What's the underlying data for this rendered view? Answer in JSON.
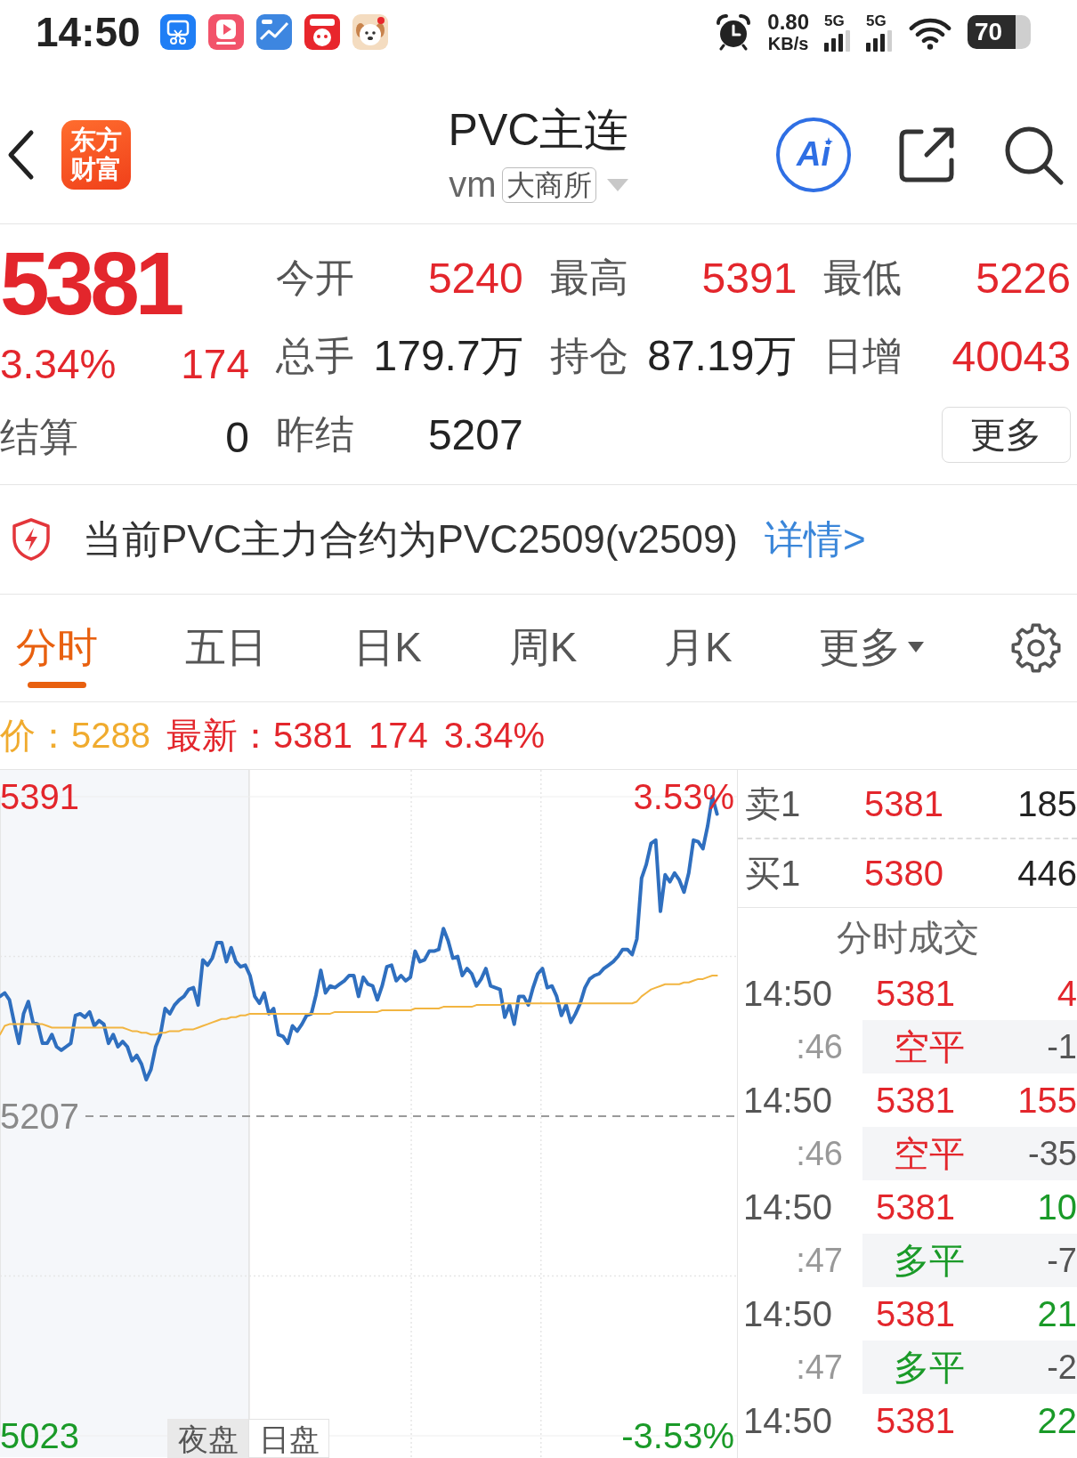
{
  "status_bar": {
    "time": "14:50",
    "speed": "0.80",
    "speed_unit": "KB/s",
    "networks": [
      "5G",
      "5G"
    ],
    "battery": "70"
  },
  "header": {
    "logo": [
      "东方",
      "财富"
    ],
    "title": "PVC主连",
    "code": "vm",
    "exchange": "大商所",
    "ai_label": "Ai"
  },
  "quote": {
    "price": "5381",
    "change_percent": "3.34%",
    "change": "174",
    "settle_label": "结算",
    "settle": "0",
    "stats": [
      {
        "label": "今开",
        "value": "5240",
        "color": "#e3262c"
      },
      {
        "label": "最高",
        "value": "5391",
        "color": "#e3262c"
      },
      {
        "label": "最低",
        "value": "5226",
        "color": "#e3262c"
      },
      {
        "label": "总手",
        "value": "179.7万",
        "color": "#222222"
      },
      {
        "label": "持仓",
        "value": "87.19万",
        "color": "#222222"
      },
      {
        "label": "日增",
        "value": "40043",
        "color": "#e3262c"
      },
      {
        "label": "昨结",
        "value": "5207",
        "color": "#222222"
      }
    ],
    "more": "更多"
  },
  "notice": {
    "text": "当前PVC主力合约为PVC2509(v2509)",
    "link": "详情>"
  },
  "tabs": [
    {
      "label": "分时",
      "selected": true,
      "kind": "tab"
    },
    {
      "label": "五日",
      "selected": false,
      "kind": "tab"
    },
    {
      "label": "日K",
      "selected": false,
      "kind": "tab"
    },
    {
      "label": "周K",
      "selected": false,
      "kind": "tab"
    },
    {
      "label": "月K",
      "selected": false,
      "kind": "tab"
    },
    {
      "label": "更多",
      "selected": false,
      "kind": "dropdown"
    }
  ],
  "summary": [
    {
      "text": "价：5288",
      "color": "#f0ab2e"
    },
    {
      "text": "最新：5381",
      "color": "#e3262c"
    },
    {
      "text": "174",
      "color": "#e3262c"
    },
    {
      "text": "3.34%",
      "color": "#e3262c"
    }
  ],
  "chart": {
    "chart_data": {
      "type": "line",
      "ylim": [
        5023,
        5391
      ],
      "yticks": [
        {
          "value": 5391,
          "label": "5391"
        },
        {
          "value": 5207,
          "label": "5207"
        },
        {
          "value": 5023,
          "label": "5023"
        }
      ],
      "ref_lines": [
        {
          "axis": "y",
          "value": 5207
        }
      ],
      "series": [
        {
          "color": "#2f6fbf",
          "values": [
            5276,
            5278,
            5274,
            5261,
            5249,
            5266,
            5273,
            5261,
            5260,
            5249,
            5249,
            5254,
            5247,
            5245,
            5247,
            5249,
            5265,
            5266,
            5264,
            5267,
            5259,
            5262,
            5260,
            5249,
            5254,
            5247,
            5250,
            5247,
            5239,
            5242,
            5237,
            5228,
            5234,
            5247,
            5254,
            5269,
            5266,
            5271,
            5274,
            5276,
            5280,
            5281,
            5271,
            5297,
            5294,
            5298,
            5307,
            5307,
            5296,
            5304,
            5296,
            5293,
            5294,
            5288,
            5276,
            5272,
            5278,
            5266,
            5269,
            5254,
            5253,
            5249,
            5259,
            5256,
            5260,
            5265,
            5266,
            5277,
            5291,
            5278,
            5282,
            5281,
            5283,
            5285,
            5288,
            5288,
            5276,
            5287,
            5283,
            5282,
            5274,
            5282,
            5293,
            5294,
            5285,
            5288,
            5285,
            5287,
            5302,
            5296,
            5297,
            5302,
            5302,
            5303,
            5315,
            5308,
            5298,
            5299,
            5288,
            5292,
            5289,
            5282,
            5286,
            5292,
            5282,
            5281,
            5280,
            5264,
            5271,
            5260,
            5276,
            5276,
            5271,
            5281,
            5289,
            5292,
            5281,
            5282,
            5276,
            5265,
            5271,
            5261,
            5266,
            5272,
            5281,
            5286,
            5288,
            5289,
            5292,
            5294,
            5296,
            5299,
            5303,
            5303,
            5300,
            5309,
            5344,
            5352,
            5364,
            5366,
            5325,
            5346,
            5342,
            5347,
            5343,
            5336,
            5347,
            5366,
            5365,
            5361,
            5374,
            5391,
            5381
          ]
        },
        {
          "color": "#f2b541",
          "values": [
            5254,
            5259,
            5260,
            5260,
            5260,
            5260,
            5260,
            5260,
            5260,
            5260,
            5259,
            5258,
            5258,
            5258,
            5258,
            5258,
            5258,
            5258,
            5258,
            5258,
            5258,
            5258,
            5258,
            5258,
            5258,
            5258,
            5258,
            5257,
            5256,
            5256,
            5255,
            5255,
            5254,
            5254,
            5255,
            5255,
            5256,
            5256,
            5256,
            5257,
            5257,
            5257,
            5258,
            5259,
            5260,
            5261,
            5262,
            5263,
            5263,
            5264,
            5264,
            5265,
            5265,
            5266,
            5266,
            5266,
            5266,
            5266,
            5266,
            5266,
            5266,
            5266,
            5266,
            5266,
            5266,
            5266,
            5266,
            5266,
            5266,
            5266,
            5266,
            5267,
            5267,
            5267,
            5267,
            5267,
            5267,
            5267,
            5267,
            5267,
            5267,
            5268,
            5268,
            5268,
            5268,
            5268,
            5268,
            5268,
            5269,
            5269,
            5269,
            5269,
            5269,
            5269,
            5270,
            5270,
            5270,
            5270,
            5270,
            5270,
            5270,
            5271,
            5271,
            5271,
            5271,
            5271,
            5271,
            5272,
            5272,
            5272,
            5272,
            5272,
            5272,
            5272,
            5272,
            5272,
            5272,
            5272,
            5272,
            5272,
            5272,
            5272,
            5272,
            5272,
            5272,
            5272,
            5272,
            5272,
            5272,
            5272,
            5272,
            5272,
            5272,
            5272,
            5272,
            5273,
            5276,
            5278,
            5280,
            5281,
            5282,
            5283,
            5283,
            5283,
            5283,
            5284,
            5284,
            5285,
            5286,
            5286,
            5287,
            5288,
            5288
          ]
        }
      ]
    },
    "change_labels": [
      "3.53%",
      "-3.53%"
    ],
    "sessions": [
      {
        "label": "夜盘",
        "selected": true
      },
      {
        "label": "日盘",
        "selected": false
      }
    ]
  },
  "order_book": [
    {
      "label": "卖1",
      "price": "5381",
      "volume": "185"
    },
    {
      "label": "买1",
      "price": "5380",
      "volume": "446"
    }
  ],
  "trades": {
    "title": "分时成交",
    "rows": [
      {
        "time": "14:50",
        "price": "5381",
        "volume": "4",
        "color": "#e3262c",
        "seconds": ":46",
        "type": "空平",
        "change": "-1"
      },
      {
        "time": "14:50",
        "price": "5381",
        "volume": "155",
        "color": "#e3262c",
        "seconds": ":46",
        "type": "空平",
        "change": "-35"
      },
      {
        "time": "14:50",
        "price": "5381",
        "volume": "10",
        "color": "#1a9a28",
        "seconds": ":47",
        "type": "多平",
        "change": "-7"
      },
      {
        "time": "14:50",
        "price": "5381",
        "volume": "21",
        "color": "#1a9a28",
        "seconds": ":47",
        "type": "多平",
        "change": "-2"
      },
      {
        "time": "14:50",
        "price": "5381",
        "volume": "22",
        "color": "#1a9a28"
      }
    ]
  }
}
